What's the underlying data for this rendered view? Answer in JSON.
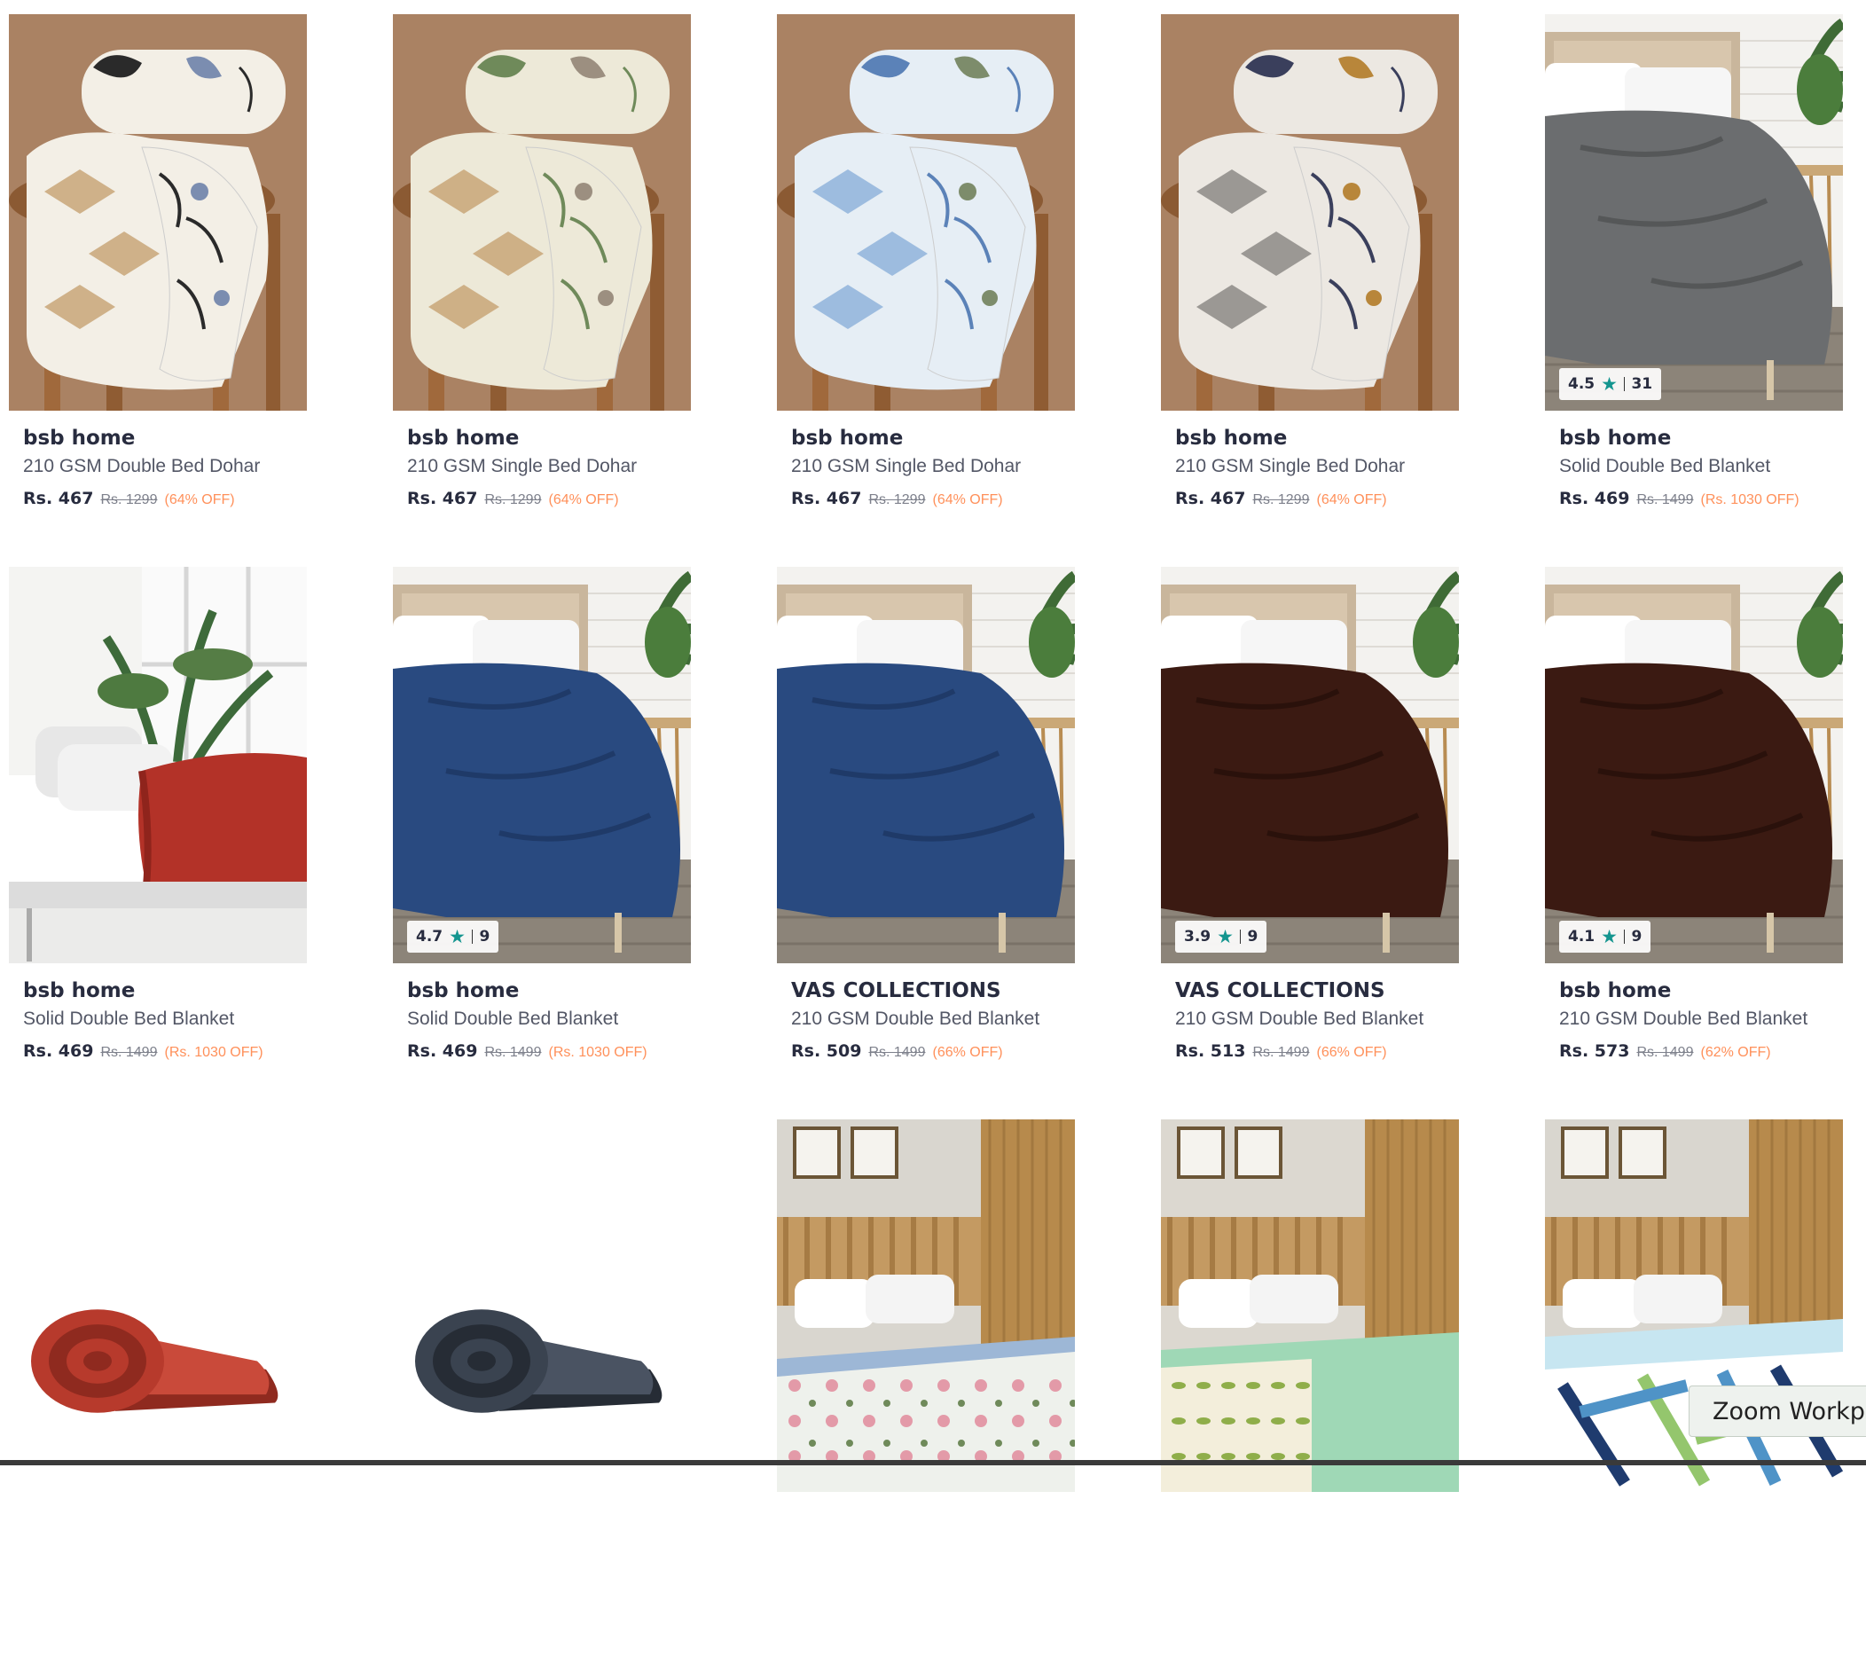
{
  "products": [
    {
      "brand": "bsb home",
      "name": "210 GSM Double Bed Dohar",
      "price": "Rs. 467",
      "mrp": "Rs. 1299",
      "discount": "(64% OFF)",
      "rating": null,
      "rating_count": null,
      "image": "folded-dohar-beige-floral-icon"
    },
    {
      "brand": "bsb home",
      "name": "210 GSM Single Bed Dohar",
      "price": "Rs. 467",
      "mrp": "Rs. 1299",
      "discount": "(64% OFF)",
      "rating": null,
      "rating_count": null,
      "image": "folded-dohar-green-floral-icon"
    },
    {
      "brand": "bsb home",
      "name": "210 GSM Single Bed Dohar",
      "price": "Rs. 467",
      "mrp": "Rs. 1299",
      "discount": "(64% OFF)",
      "rating": null,
      "rating_count": null,
      "image": "folded-dohar-blue-floral-icon"
    },
    {
      "brand": "bsb home",
      "name": "210 GSM Single Bed Dohar",
      "price": "Rs. 467",
      "mrp": "Rs. 1299",
      "discount": "(64% OFF)",
      "rating": null,
      "rating_count": null,
      "image": "folded-dohar-paisley-icon"
    },
    {
      "brand": "bsb home",
      "name": "Solid Double Bed Blanket",
      "price": "Rs. 469",
      "mrp": "Rs. 1499",
      "discount": "(Rs. 1030 OFF)",
      "rating": "4.5",
      "rating_count": "31",
      "image": "bed-blanket-grey-icon"
    },
    {
      "brand": "bsb home",
      "name": "Solid Double Bed Blanket",
      "price": "Rs. 469",
      "mrp": "Rs. 1499",
      "discount": "(Rs. 1030 OFF)",
      "rating": null,
      "rating_count": null,
      "image": "bed-blanket-red-icon"
    },
    {
      "brand": "bsb home",
      "name": "Solid Double Bed Blanket",
      "price": "Rs. 469",
      "mrp": "Rs. 1499",
      "discount": "(Rs. 1030 OFF)",
      "rating": "4.7",
      "rating_count": "9",
      "image": "bed-blanket-navy-icon"
    },
    {
      "brand": "VAS COLLECTIONS",
      "name": "210 GSM Double Bed Blanket",
      "price": "Rs. 509",
      "mrp": "Rs. 1499",
      "discount": "(66% OFF)",
      "rating": null,
      "rating_count": null,
      "image": "bed-blanket-navy-icon"
    },
    {
      "brand": "VAS COLLECTIONS",
      "name": "210 GSM Double Bed Blanket",
      "price": "Rs. 513",
      "mrp": "Rs. 1499",
      "discount": "(66% OFF)",
      "rating": "3.9",
      "rating_count": "9",
      "image": "bed-blanket-brown-icon"
    },
    {
      "brand": "bsb home",
      "name": "210 GSM Double Bed Blanket",
      "price": "Rs. 573",
      "mrp": "Rs. 1499",
      "discount": "(62% OFF)",
      "rating": "4.1",
      "rating_count": "9",
      "image": "bed-blanket-brown-icon"
    },
    {
      "brand": "",
      "name": "",
      "price": "",
      "mrp": "",
      "discount": "",
      "rating": null,
      "rating_count": null,
      "image": "rolled-blanket-red-icon"
    },
    {
      "brand": "",
      "name": "",
      "price": "",
      "mrp": "",
      "discount": "",
      "rating": null,
      "rating_count": null,
      "image": "rolled-blanket-charcoal-icon"
    },
    {
      "brand": "",
      "name": "",
      "price": "",
      "mrp": "",
      "discount": "",
      "rating": null,
      "rating_count": null,
      "image": "bed-floral-pink-icon"
    },
    {
      "brand": "",
      "name": "",
      "price": "",
      "mrp": "",
      "discount": "",
      "rating": null,
      "rating_count": null,
      "image": "bed-leaf-green-icon"
    },
    {
      "brand": "",
      "name": "",
      "price": "",
      "mrp": "",
      "discount": "",
      "rating": null,
      "rating_count": null,
      "image": "bed-geometric-blue-icon"
    }
  ],
  "zoom_tab": {
    "label": "Zoom Workpl"
  },
  "colors": {
    "brand_text": "#282c3f",
    "name_text": "#535766",
    "mrp_text": "#7e818c",
    "discount_text": "#ff905a",
    "rating_star": "#14958f"
  }
}
